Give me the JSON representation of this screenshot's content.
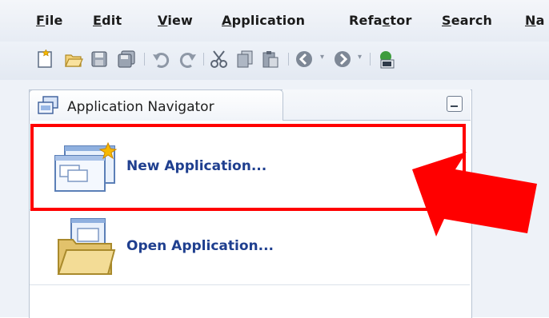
{
  "menu": {
    "items": [
      {
        "label": "File",
        "mnemonic": "F",
        "rest": "ile"
      },
      {
        "label": "Edit",
        "mnemonic": "E",
        "rest": "dit"
      },
      {
        "label": "View",
        "mnemonic": "V",
        "rest": "iew"
      },
      {
        "label": "Application",
        "mnemonic": "A",
        "rest": "pplication"
      },
      {
        "label": "Refactor",
        "prefix": "Refa",
        "mnemonic": "c",
        "rest": "tor"
      },
      {
        "label": "Search",
        "mnemonic": "S",
        "rest": "earch"
      },
      {
        "label": "Na",
        "mnemonic": "N",
        "rest": "a"
      }
    ]
  },
  "toolbar": {
    "icons": [
      "new-icon",
      "open-icon",
      "save-icon",
      "save-all-icon",
      "undo-icon",
      "redo-icon",
      "cut-icon",
      "copy-icon",
      "paste-icon",
      "back-icon",
      "forward-icon",
      "soa-icon"
    ]
  },
  "navigator": {
    "title": "Application Navigator",
    "new_application_label": "New Application...",
    "open_application_label": "Open Application..."
  },
  "annotation": {
    "highlight_color": "#ff0000",
    "arrow_color": "#ff0000"
  }
}
